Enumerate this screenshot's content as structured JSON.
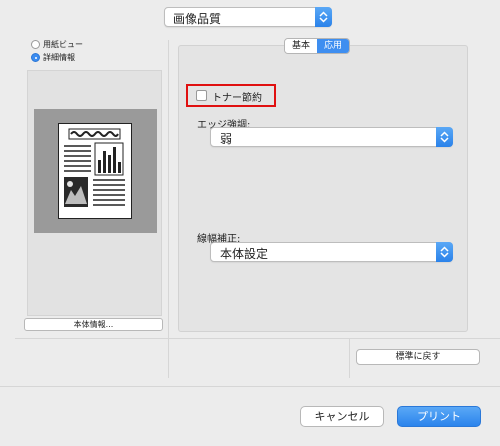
{
  "header": {
    "panel_select_value": "画像品質"
  },
  "preview_mode": {
    "options": [
      {
        "label": "用紙ビュー",
        "selected": false
      },
      {
        "label": "詳細情報",
        "selected": true
      }
    ]
  },
  "preview": {
    "doc_headline": ""
  },
  "info_button": {
    "label": "本体情報..."
  },
  "tabs": [
    {
      "label": "基本",
      "active": false
    },
    {
      "label": "応用",
      "active": true
    }
  ],
  "toner_save": {
    "label": "トナー節約",
    "checked": false
  },
  "edge_emphasis": {
    "label": "エッジ強調:",
    "value": "弱"
  },
  "line_width": {
    "label": "線幅補正:",
    "value": "本体設定"
  },
  "reset_button": {
    "label": "標準に戻す"
  },
  "footer": {
    "cancel_label": "キャンセル",
    "print_label": "プリント"
  },
  "colors": {
    "accent": "#3e8ef0",
    "highlight": "#e01010"
  }
}
